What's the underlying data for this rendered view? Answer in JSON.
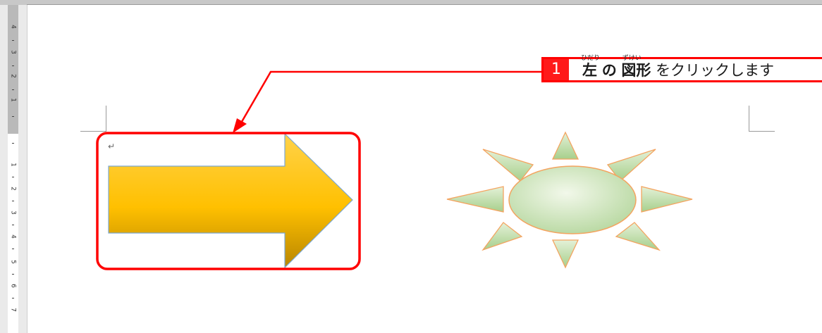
{
  "ruler": {
    "numbers": [
      "4",
      "3",
      "2",
      "1",
      "1",
      "2",
      "3",
      "4",
      "5",
      "6",
      "7"
    ]
  },
  "callout": {
    "step_number": "1",
    "text_left": "左",
    "text_no": "の",
    "text_zukei": "図形",
    "text_rest": "をクリックします",
    "ruby_hidari": "ひだり",
    "ruby_zukei": "ずけい",
    "border_color": "#ff0000"
  },
  "document": {
    "paragraph_mark": "↵"
  },
  "shapes": {
    "arrow": {
      "name": "right-arrow",
      "fill_top": "#ffd24a",
      "fill_mid": "#ffc000",
      "fill_bottom": "#b88600",
      "outline": "#7ba7d1"
    },
    "sun": {
      "name": "sun",
      "fill": "#b8d8a0",
      "outline": "#f4a460"
    }
  },
  "highlight_color": "#ff0000"
}
